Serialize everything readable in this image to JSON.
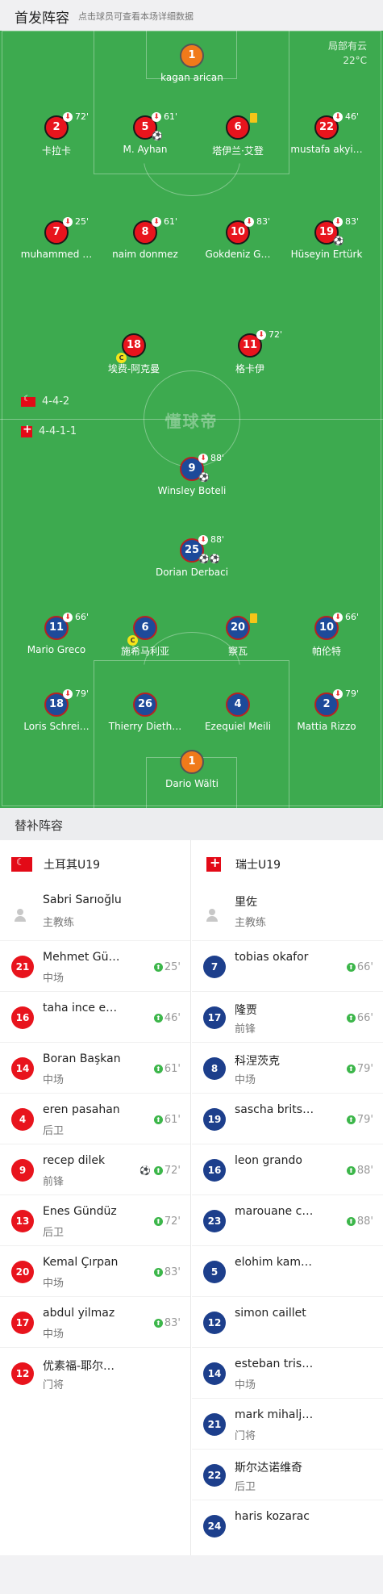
{
  "header": {
    "title": "首发阵容",
    "hint": "点击球员可查看本场详细数据"
  },
  "weather": {
    "condition": "局部有云",
    "temp": "22°C"
  },
  "watermark": "懂球帝",
  "formations": {
    "home": "4-4-2",
    "away": "4-4-1-1"
  },
  "home_lineup": [
    {
      "number": "1",
      "name": "kagan arican",
      "gk": true
    },
    {
      "number": "2",
      "name": "卡拉卡",
      "sub_min": "72'"
    },
    {
      "number": "5",
      "name": "M. Ayhan",
      "sub_min": "61'",
      "goal": "⚽"
    },
    {
      "number": "6",
      "name": "塔伊兰·艾登",
      "card": "yellow"
    },
    {
      "number": "22",
      "name": "mustafa akyi…",
      "sub_min": "46'"
    },
    {
      "number": "7",
      "name": "muhammed …",
      "sub_min": "25'"
    },
    {
      "number": "8",
      "name": "naim donmez",
      "sub_min": "61'"
    },
    {
      "number": "10",
      "name": "Gokdeniz G…",
      "sub_min": "83'"
    },
    {
      "number": "19",
      "name": "Hüseyin Ertürk",
      "sub_min": "83'",
      "goal": "⚽"
    },
    {
      "number": "18",
      "name": "埃费-阿克曼",
      "captain": "C"
    },
    {
      "number": "11",
      "name": "格卡伊",
      "sub_min": "72'"
    }
  ],
  "away_lineup": [
    {
      "number": "9",
      "name": "Winsley Boteli",
      "sub_min": "88'",
      "goal": "⚽"
    },
    {
      "number": "25",
      "name": "Dorian Derbaci",
      "sub_min": "88'",
      "goal": "⚽⚽"
    },
    {
      "number": "11",
      "name": "Mario Greco",
      "sub_min": "66'"
    },
    {
      "number": "6",
      "name": "施希马利亚",
      "captain": "C"
    },
    {
      "number": "20",
      "name": "察瓦",
      "card": "yellow"
    },
    {
      "number": "10",
      "name": "帕伦特",
      "sub_min": "66'"
    },
    {
      "number": "18",
      "name": "Loris Schrei…",
      "sub_min": "79'"
    },
    {
      "number": "26",
      "name": "Thierry Dieth…"
    },
    {
      "number": "4",
      "name": "Ezequiel Meili"
    },
    {
      "number": "2",
      "name": "Mattia Rizzo",
      "sub_min": "79'"
    },
    {
      "number": "1",
      "name": "Dario Wälti",
      "gk": true
    }
  ],
  "subs_title": "替补阵容",
  "home_team": {
    "name": "土耳其U19",
    "coach": {
      "name": "Sabri Sarıoğlu",
      "role": "主教练"
    },
    "subs": [
      {
        "number": "21",
        "name": "Mehmet Güneş",
        "pos": "中场",
        "min": "25'"
      },
      {
        "number": "16",
        "name": "taha ince emre",
        "pos": "",
        "min": "46'"
      },
      {
        "number": "14",
        "name": "Boran Başkan",
        "pos": "中场",
        "min": "61'"
      },
      {
        "number": "4",
        "name": "eren pasahan",
        "pos": "后卫",
        "min": "61'"
      },
      {
        "number": "9",
        "name": "recep dilek",
        "pos": "前锋",
        "min": "72'",
        "goal": "⚽"
      },
      {
        "number": "13",
        "name": "Enes Gündüz",
        "pos": "后卫",
        "min": "72'"
      },
      {
        "number": "20",
        "name": "Kemal Çırpan",
        "pos": "中场",
        "min": "83'"
      },
      {
        "number": "17",
        "name": "abdul yilmaz",
        "pos": "中场",
        "min": "83'"
      },
      {
        "number": "12",
        "name": "优素福-耶尔…",
        "pos": "门将",
        "min": ""
      }
    ]
  },
  "away_team": {
    "name": "瑞士U19",
    "coach": {
      "name": "里佐",
      "role": "主教练"
    },
    "subs": [
      {
        "number": "7",
        "name": "tobias okafor",
        "pos": "",
        "min": "66'"
      },
      {
        "number": "17",
        "name": "隆贾",
        "pos": "前锋",
        "min": "66'"
      },
      {
        "number": "8",
        "name": "科涅茨克",
        "pos": "中场",
        "min": "79'"
      },
      {
        "number": "19",
        "name": "sascha britsc…",
        "pos": "",
        "min": "79'"
      },
      {
        "number": "16",
        "name": "leon grando",
        "pos": "",
        "min": "88'"
      },
      {
        "number": "23",
        "name": "marouane cal…",
        "pos": "",
        "min": "88'"
      },
      {
        "number": "5",
        "name": "elohim kamoko",
        "pos": "",
        "min": ""
      },
      {
        "number": "12",
        "name": "simon caillet",
        "pos": "",
        "min": ""
      },
      {
        "number": "14",
        "name": "esteban trista…",
        "pos": "中场",
        "min": ""
      },
      {
        "number": "21",
        "name": "mark mihaljevic",
        "pos": "门将",
        "min": ""
      },
      {
        "number": "22",
        "name": "斯尔达诺维奇",
        "pos": "后卫",
        "min": ""
      },
      {
        "number": "24",
        "name": "haris kozarac",
        "pos": "",
        "min": ""
      }
    ]
  }
}
